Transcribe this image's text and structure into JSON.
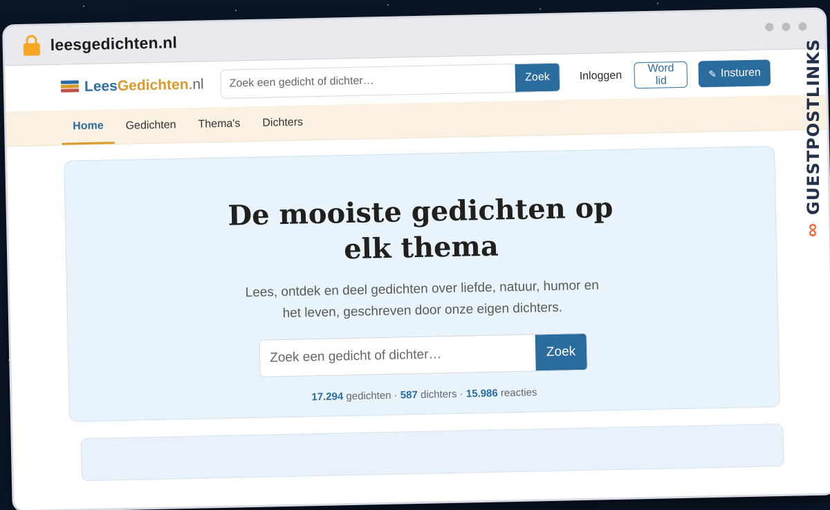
{
  "browser": {
    "url": "leesgedichten.nl"
  },
  "site": {
    "logo_part1": "Lees",
    "logo_part2": "Gedichten",
    "logo_part3": ".nl"
  },
  "header": {
    "search_placeholder": "Zoek een gedicht of dichter…",
    "search_button": "Zoek",
    "login": "Inloggen",
    "register": "Word lid",
    "submit": "Insturen"
  },
  "nav": {
    "items": [
      {
        "label": "Home",
        "active": true
      },
      {
        "label": "Gedichten"
      },
      {
        "label": "Thema's"
      },
      {
        "label": "Dichters"
      }
    ]
  },
  "hero": {
    "title": "De mooiste gedichten op elk thema",
    "subtitle": "Lees, ontdek en deel gedichten over liefde, natuur, humor en het leven, geschreven door onze eigen dichters.",
    "search_placeholder": "Zoek een gedicht of dichter…",
    "search_button": "Zoek",
    "stats": {
      "poems_count": "17.294",
      "poems_label": "gedichten",
      "poets_count": "587",
      "poets_label": "dichters",
      "reactions_count": "15.986",
      "reactions_label": "reacties"
    }
  },
  "badge": {
    "text": "GUESTPOSTLINKS"
  },
  "colors": {
    "primary": "#2b6c9e",
    "accent": "#d99a2b",
    "nav_bg": "#faf1e3",
    "hero_bg": "#e8f3fb"
  }
}
